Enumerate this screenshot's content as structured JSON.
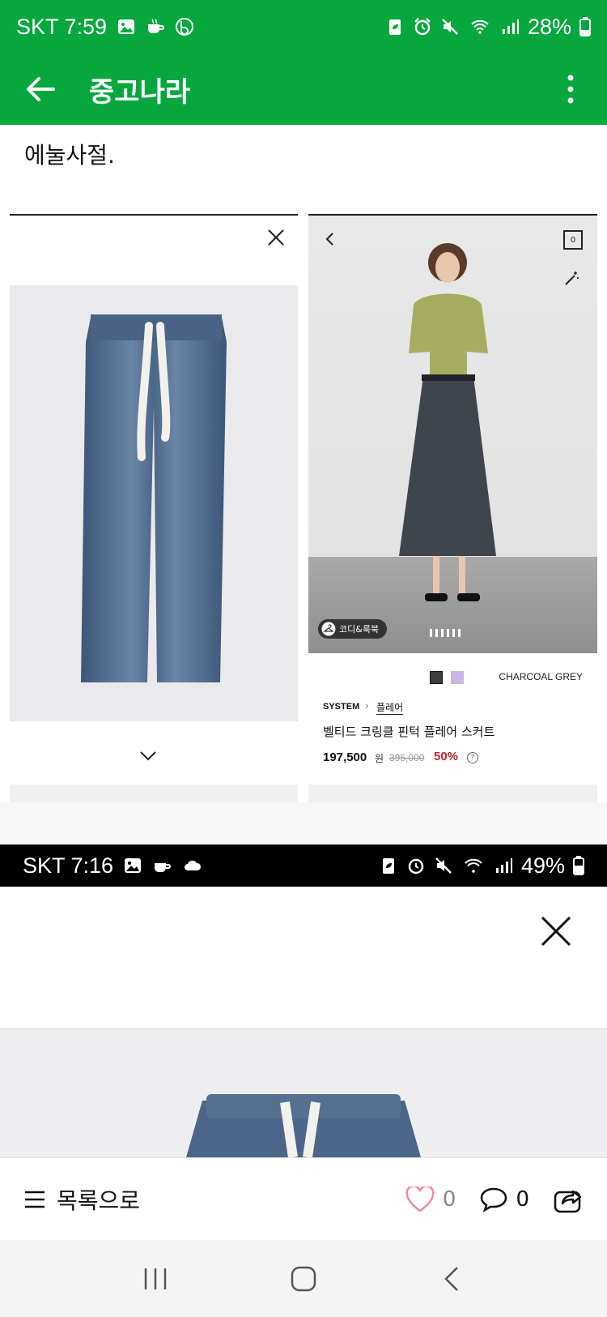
{
  "status_bar": {
    "carrier_time": "SKT 7:59",
    "battery": "28%",
    "icons": [
      "gallery-icon",
      "coffee-icon",
      "b-app-icon",
      "battery-saver-icon",
      "alarm-icon",
      "mute-icon",
      "wifi-icon",
      "signal-icon",
      "battery-icon"
    ]
  },
  "app_bar": {
    "title": "중고나라",
    "back_icon": "arrow-left-icon",
    "menu_icon": "more-vertical-icon"
  },
  "post": {
    "text": "에눌사절."
  },
  "left_screenshot": {
    "close_icon": "close-icon",
    "image": "jeans-image",
    "expand_icon": "chevron-down-icon"
  },
  "right_screenshot": {
    "back_icon": "chevron-left-icon",
    "cart_count": "0",
    "magic_icon": "magic-wand-icon",
    "badge": "코디&룩북",
    "color_name": "CHARCOAL GREY",
    "brand": "SYSTEM",
    "category": "플레어",
    "product_name": "벨티드 크링클 핀턱 플레어 스커트",
    "price": "197,500",
    "price_unit": "원",
    "original_price": "395,000",
    "discount": "50%",
    "info_icon": "?",
    "colors": {
      "charcoal": "#3a3d42",
      "lavender": "#c9b6e4"
    }
  },
  "status_bar_2": {
    "carrier_time": "SKT 7:16",
    "battery": "49%"
  },
  "bottom_bar": {
    "list_label": "목록으로",
    "like_count": "0",
    "comment_count": "0"
  },
  "colors": {
    "brand_green": "#06a83e",
    "like_pink": "#f08a9a",
    "discount_red": "#c0262d"
  }
}
